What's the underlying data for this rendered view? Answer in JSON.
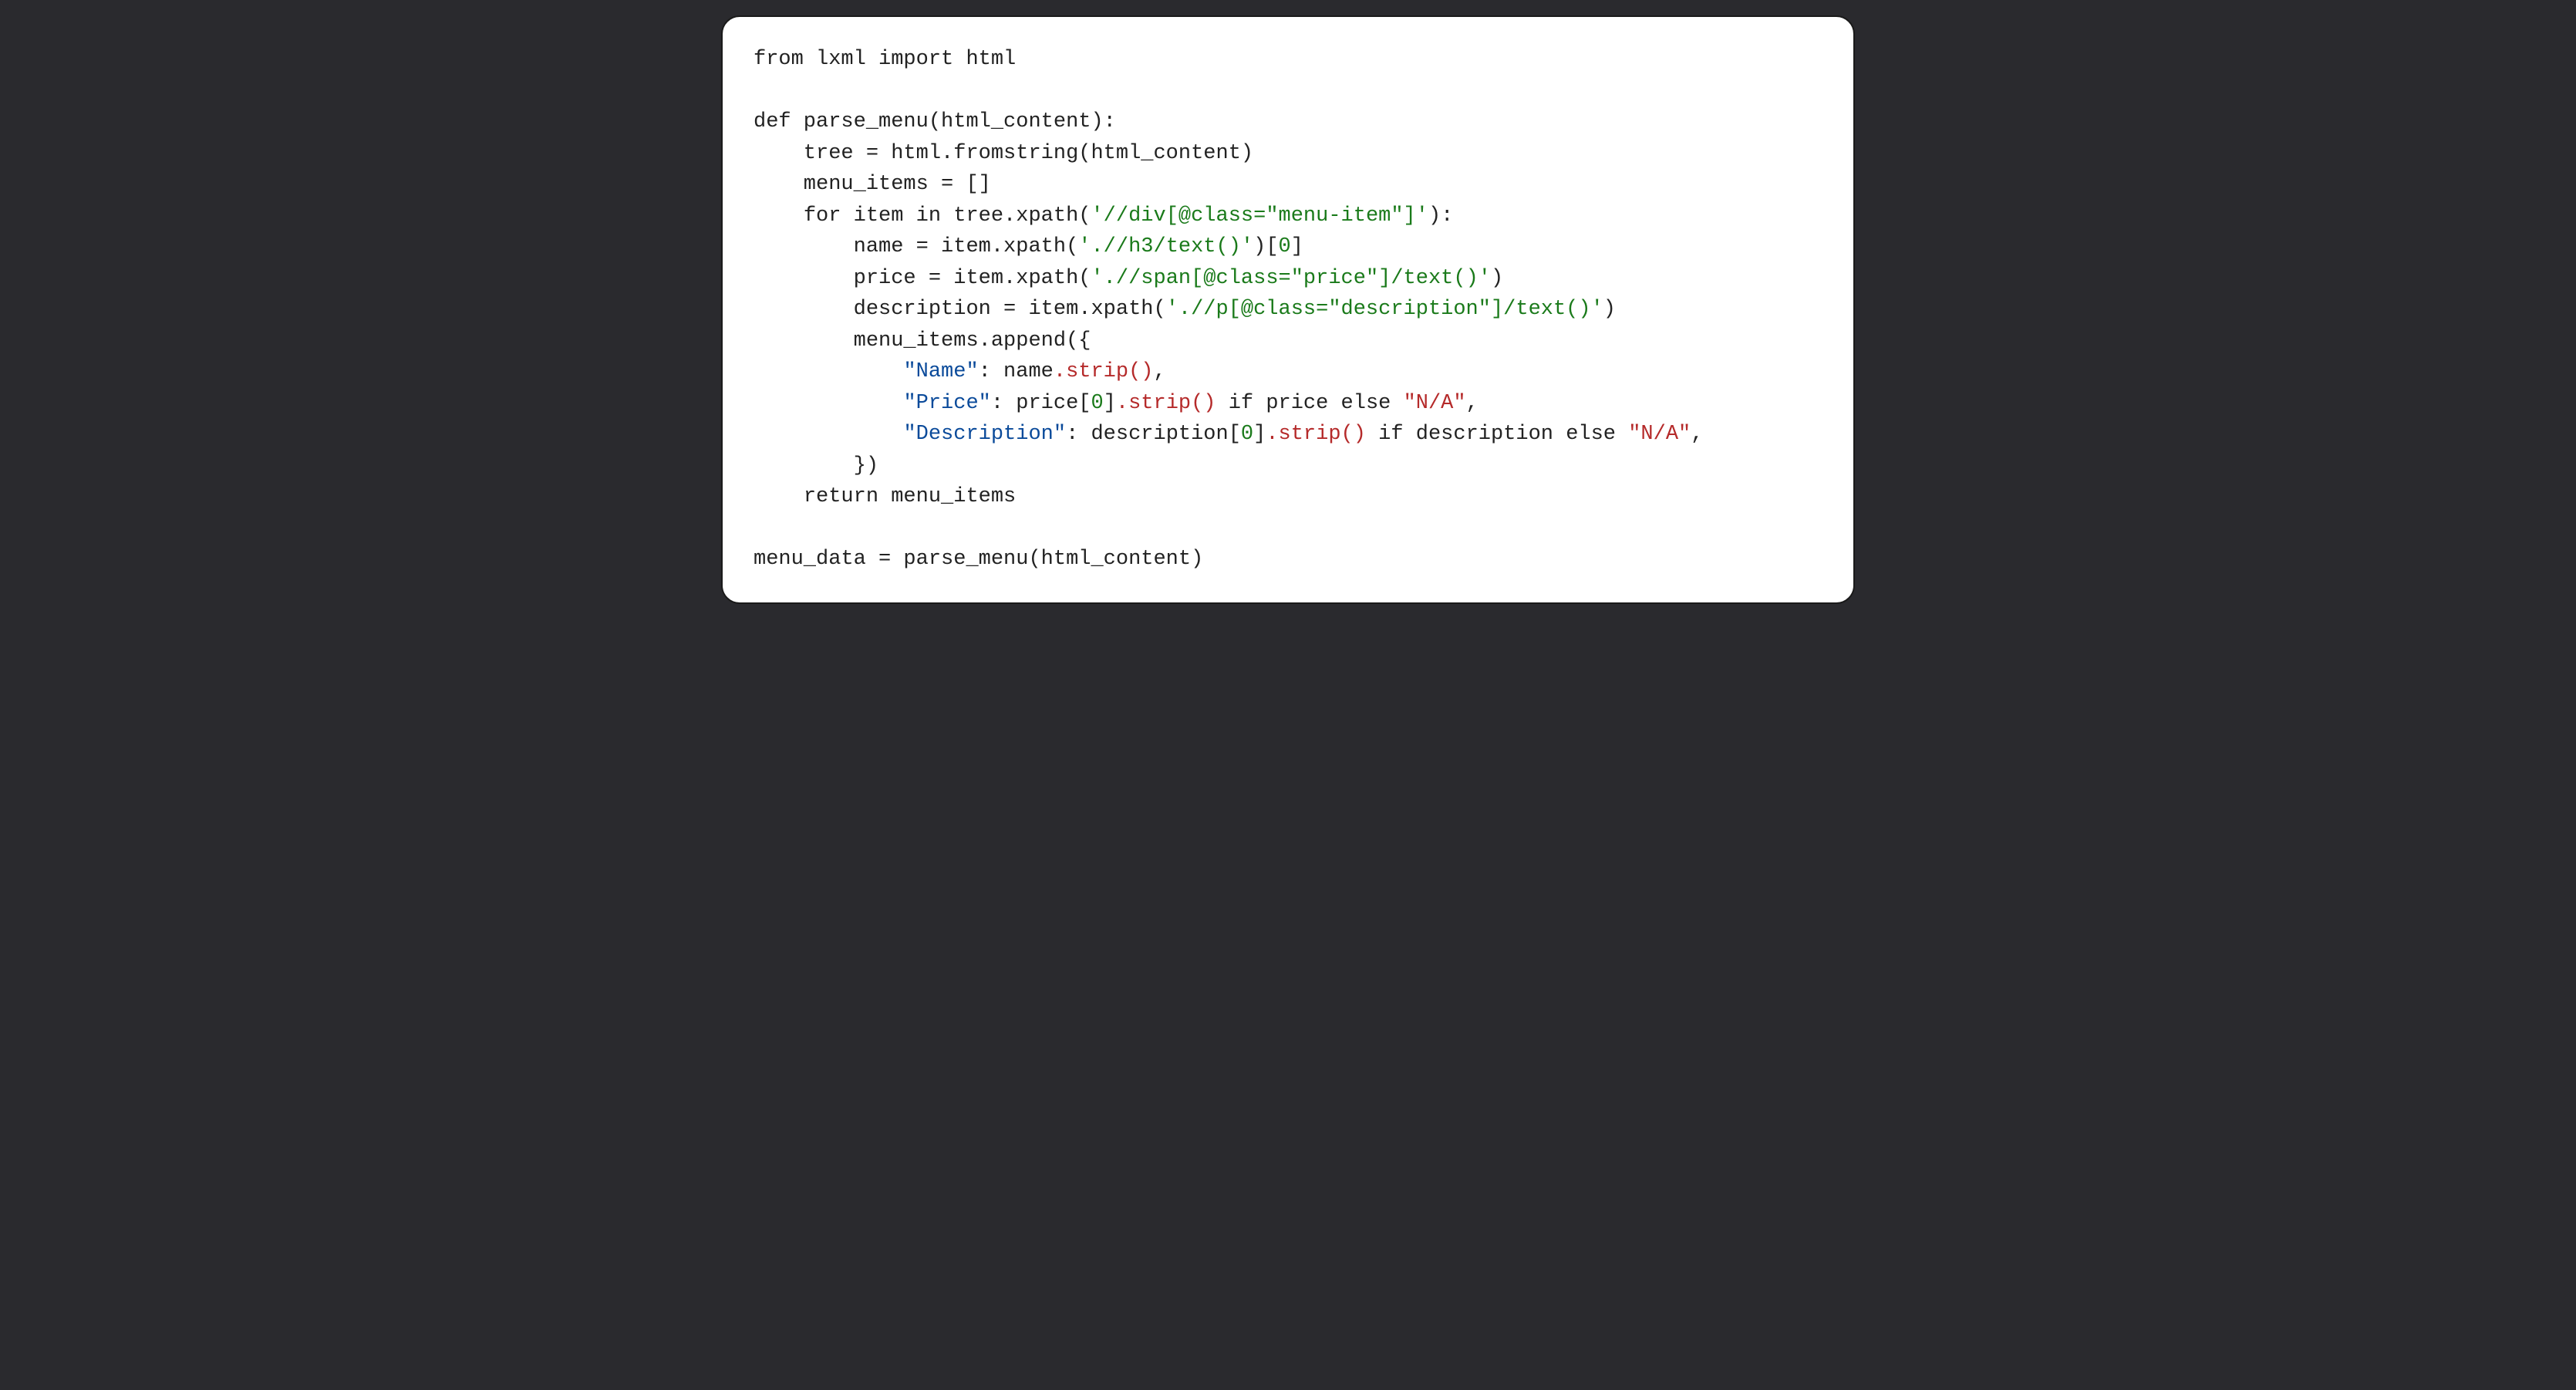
{
  "code": {
    "line1": {
      "t1": "from",
      "t2": " lxml ",
      "t3": "import",
      "t4": " html"
    },
    "line3": {
      "t1": "def",
      "t2": " parse_menu(html_content):"
    },
    "line4": {
      "t1": "    tree = html.fromstring(html_content)"
    },
    "line5": {
      "t1": "    menu_items = []"
    },
    "line6": {
      "t1": "    ",
      "t2": "for",
      "t3": " item ",
      "t4": "in",
      "t5": " tree.xpath(",
      "s1": "'//div[@class=\"menu-item\"]'",
      "t7": "):"
    },
    "line7": {
      "t1": "        name = item.xpath(",
      "s1": "'.//h3/text()'",
      "t2": ")[",
      "n1": "0",
      "t3": "]"
    },
    "line8": {
      "t1": "        price = item.xpath(",
      "s1": "'.//span[@class=\"price\"]/text()'",
      "t2": ")"
    },
    "line9": {
      "t1": "        description = item.xpath(",
      "s1": "'.//p[@class=\"description\"]/text()'",
      "t2": ")"
    },
    "line10": {
      "t1": "        menu_items.append({"
    },
    "line11": {
      "t1": "            ",
      "k1": "\"Name\"",
      "t2": ": name",
      "m1": ".strip()",
      "t3": ","
    },
    "line12": {
      "t1": "            ",
      "k1": "\"Price\"",
      "t2": ": price[",
      "n1": "0",
      "t3": "]",
      "m1": ".strip()",
      "t4": " ",
      "kw1": "if",
      "t5": " price ",
      "kw2": "else",
      "t6": " ",
      "r1": "\"N/A\"",
      "t7": ","
    },
    "line13": {
      "t1": "            ",
      "k1": "\"Description\"",
      "t2": ": description[",
      "n1": "0",
      "t3": "]",
      "m1": ".strip()",
      "t4": " ",
      "kw1": "if",
      "t5": " description ",
      "kw2": "else",
      "t6": " ",
      "r1": "\"N/A\"",
      "t7": ","
    },
    "line14": {
      "t1": "        })"
    },
    "line15": {
      "t1": "    ",
      "kw1": "return",
      "t2": " menu_items"
    },
    "line17": {
      "t1": "menu_data = parse_menu(html_content)"
    }
  }
}
